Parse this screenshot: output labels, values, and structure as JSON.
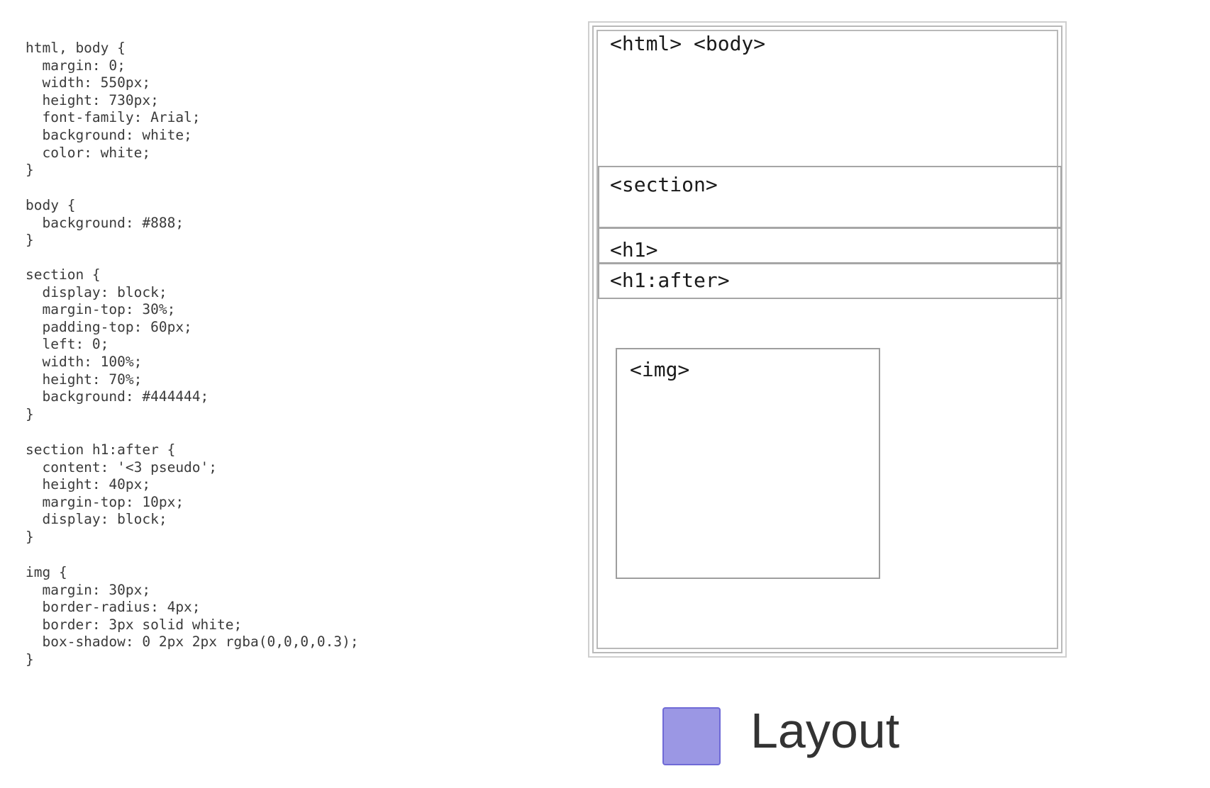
{
  "code_blocks": [
    {
      "lines": [
        "html, body {",
        "  margin: 0;",
        "  width: 550px;",
        "  height: 730px;",
        "  font-family: Arial;",
        "  background: white;",
        "  color: white;",
        "}"
      ]
    },
    {
      "lines": [
        "body {",
        "  background: #888;",
        "}"
      ]
    },
    {
      "lines": [
        "section {",
        "  display: block;",
        "  margin-top: 30%;",
        "  padding-top: 60px;",
        "  left: 0;",
        "  width: 100%;",
        "  height: 70%;",
        "  background: #444444;",
        "}"
      ]
    },
    {
      "lines": [
        "section h1:after {",
        "  content: '<3 pseudo';",
        "  height: 40px;",
        "  margin-top: 10px;",
        "  display: block;",
        "}"
      ]
    },
    {
      "lines": [
        "img {",
        "  margin: 30px;",
        "  border-radius: 4px;",
        "  border: 3px solid white;",
        "  box-shadow: 0 2px 2px rgba(0,0,0,0.3);",
        "}"
      ]
    }
  ],
  "diagram": {
    "html_body_label": "<html> <body>",
    "section_label": "<section>",
    "h1_label": "<h1>",
    "h1_after_label": "<h1:after>",
    "img_label": "<img>"
  },
  "legend": {
    "label": "Layout",
    "swatch_color": "#9b97e4"
  }
}
